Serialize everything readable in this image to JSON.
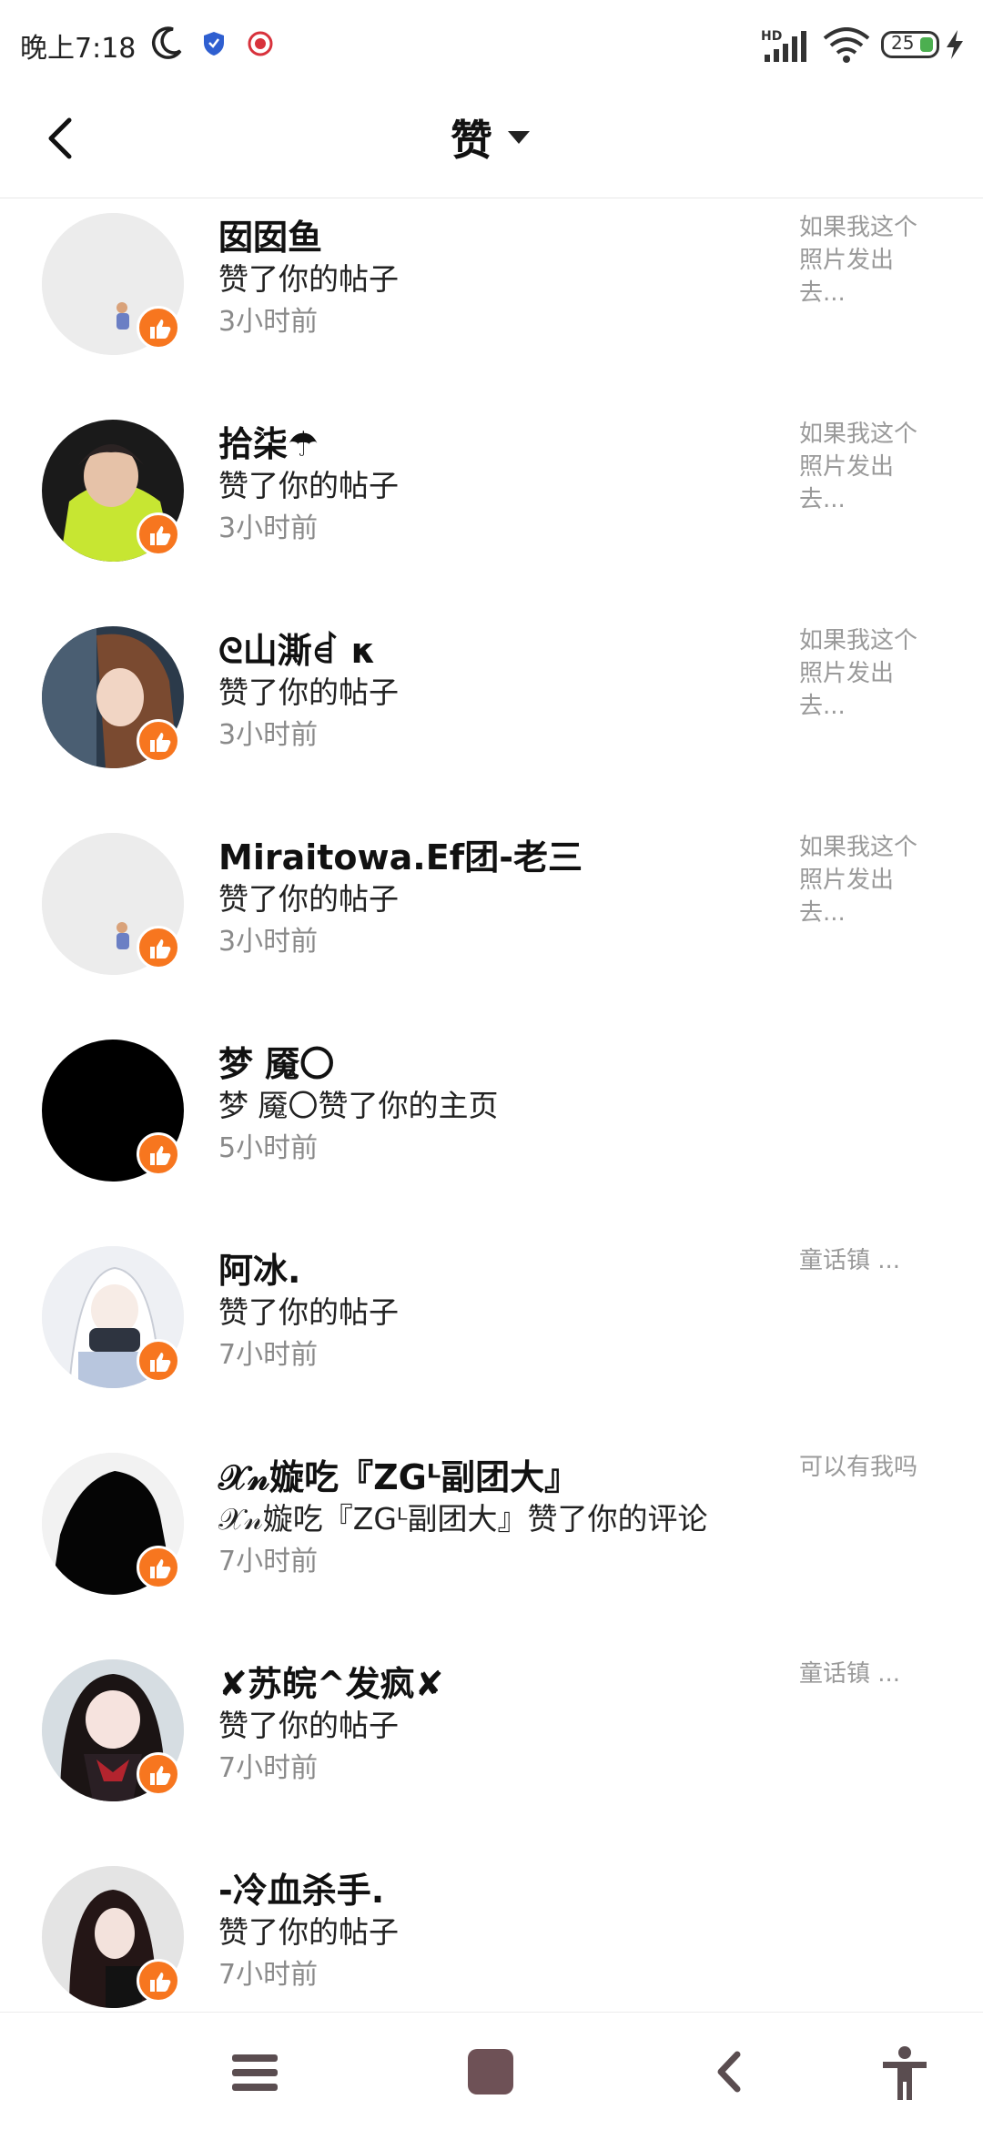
{
  "status_bar": {
    "time": "晚上7:18",
    "network": "HD",
    "battery": "25",
    "icons": [
      "moon-icon",
      "shield-icon",
      "app-badge-icon",
      "signal-icon",
      "wifi-icon",
      "battery-icon",
      "charging-icon"
    ]
  },
  "header": {
    "title": "赞",
    "back_icon": "back-arrow-icon",
    "dropdown_icon": "caret-down-icon"
  },
  "notifications": [
    {
      "name": "囡囡鱼",
      "action": "赞了你的帖子",
      "time": "3小时前",
      "preview": "如果我这个照片发出去...",
      "avatar": "light"
    },
    {
      "name": "拾柒☂",
      "action": "赞了你的帖子",
      "time": "3小时前",
      "preview": "如果我这个照片发出去...",
      "avatar": "green-hoodie"
    },
    {
      "name": "ᘓ山澌ꀸ κ",
      "action": "赞了你的帖子",
      "time": "3小时前",
      "preview": "如果我这个照片发出去...",
      "avatar": "portrait"
    },
    {
      "name": "Miraitowa.Ef团-老三",
      "action": "赞了你的帖子",
      "time": "3小时前",
      "preview": "如果我这个照片发出去...",
      "avatar": "light"
    },
    {
      "name": "梦 魇〇",
      "action": "梦 魇〇赞了你的主页",
      "time": "5小时前",
      "preview": "",
      "avatar": "black"
    },
    {
      "name": "阿冰.",
      "action": "赞了你的帖子",
      "time": "7小时前",
      "preview": "童话镇 ...",
      "avatar": "anime-white"
    },
    {
      "name": "𝒳𝓃嫙吃『ZGᴸ副团大』",
      "action": "𝒳𝓃嫙吃『ZGᴸ副团大』赞了你的评论",
      "time": "7小时前",
      "preview": "可以有我吗",
      "avatar": "silhouette"
    },
    {
      "name": "✘苏皖^发疯✘",
      "action": "赞了你的帖子",
      "time": "7小时前",
      "preview": "童话镇 ...",
      "avatar": "anime-red"
    },
    {
      "name": "-冷血杀手.",
      "action": "赞了你的帖子",
      "time": "7小时前",
      "preview": "",
      "avatar": "dark-hair"
    }
  ],
  "nav_bar": {
    "icons": [
      "menu-icon",
      "home-icon",
      "back-icon",
      "accessibility-icon"
    ]
  },
  "colors": {
    "like_badge": "#f7761f",
    "home_button": "#6e5156",
    "time_text": "#8a8a8a",
    "preview_text": "#9a9a9a"
  }
}
